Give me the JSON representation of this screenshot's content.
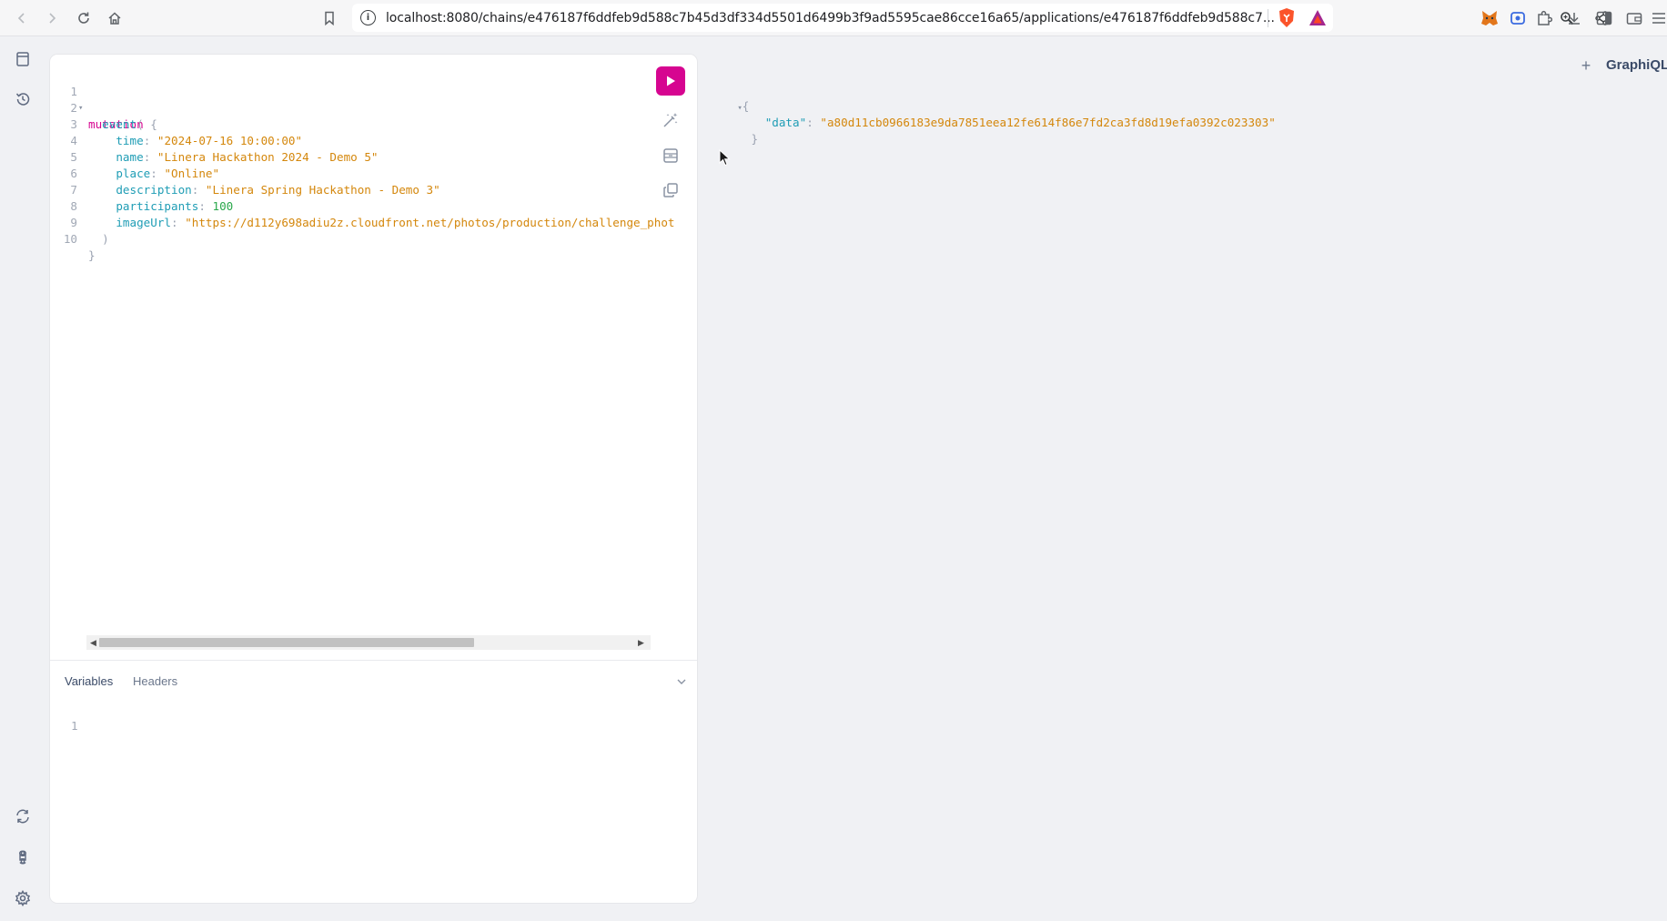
{
  "browser": {
    "url": "localhost:8080/chains/e476187f6ddfeb9d588c7b45d3df334d5501d6499b3f9ad5595cae86cce16a65/applications/e476187f6ddfeb9d588c7...",
    "icons": [
      "back-icon",
      "forward-icon",
      "reload-icon",
      "home-icon",
      "bookmark-icon",
      "site-info-icon",
      "zoom-icon",
      "share-icon",
      "brave-shields-icon",
      "brave-rewards-icon",
      "metamask-icon",
      "extension-icon",
      "puzzle-icon",
      "download-icon",
      "sidebar-icon",
      "wallet-icon",
      "menu-icon"
    ]
  },
  "sidebar": {
    "top_icons": [
      "docs-icon",
      "history-icon"
    ],
    "bottom_icons": [
      "refetch-schema-icon",
      "shortcuts-icon",
      "settings-icon"
    ]
  },
  "editor": {
    "lines": [
      {
        "n": "1",
        "text": "mutation {"
      },
      {
        "n": "2",
        "text": "  event("
      },
      {
        "n": "3",
        "text": "    time: \"2024-07-16 10:00:00\""
      },
      {
        "n": "4",
        "text": "    name: \"Linera Hackathon 2024 - Demo 5\""
      },
      {
        "n": "5",
        "text": "    place: \"Online\""
      },
      {
        "n": "6",
        "text": "    description: \"Linera Spring Hackathon - Demo 3\""
      },
      {
        "n": "7",
        "text": "    participants: 100"
      },
      {
        "n": "8",
        "text": "    imageUrl: \"https://d112y698adiu2z.cloudfront.net/photos/production/challenge_phot"
      },
      {
        "n": "9",
        "text": "  )"
      },
      {
        "n": "10",
        "text": "}"
      }
    ],
    "tokens": {
      "l1_kw": "mutation",
      "l1_p": " {",
      "l2_f": "event",
      "l2_p": "(",
      "l3_a": "time",
      "l3_v": "\"2024-07-16 10:00:00\"",
      "l4_a": "name",
      "l4_v": "\"Linera Hackathon 2024 - Demo 5\"",
      "l5_a": "place",
      "l5_v": "\"Online\"",
      "l6_a": "description",
      "l6_v": "\"Linera Spring Hackathon - Demo 3\"",
      "l7_a": "participants",
      "l7_v": "100",
      "l8_a": "imageUrl",
      "l8_v": "\"https://d112y698adiu2z.cloudfront.net/photos/production/challenge_phot",
      "l9_p": ")",
      "l10_p": "}"
    },
    "toolbar_icons": [
      "execute-icon",
      "prettify-icon",
      "merge-fragments-icon",
      "copy-query-icon"
    ]
  },
  "variables_panel": {
    "tabs": [
      "Variables",
      "Headers"
    ],
    "active_tab": "Variables",
    "line_number": "1"
  },
  "result": {
    "open": "{",
    "key": "\"data\"",
    "value": "\"a80d11cb0966183e9da7851eea12fe614f86e7fd2ca3fd8d19efa0392c023303\"",
    "close": "}"
  },
  "header": {
    "title": "GraphiQL",
    "plus": "+"
  },
  "colors": {
    "accent": "#d60590",
    "string": "#d4870c",
    "field": "#1f9db5",
    "number": "#2aa84b",
    "panel_bg": "#f0f1f4"
  }
}
